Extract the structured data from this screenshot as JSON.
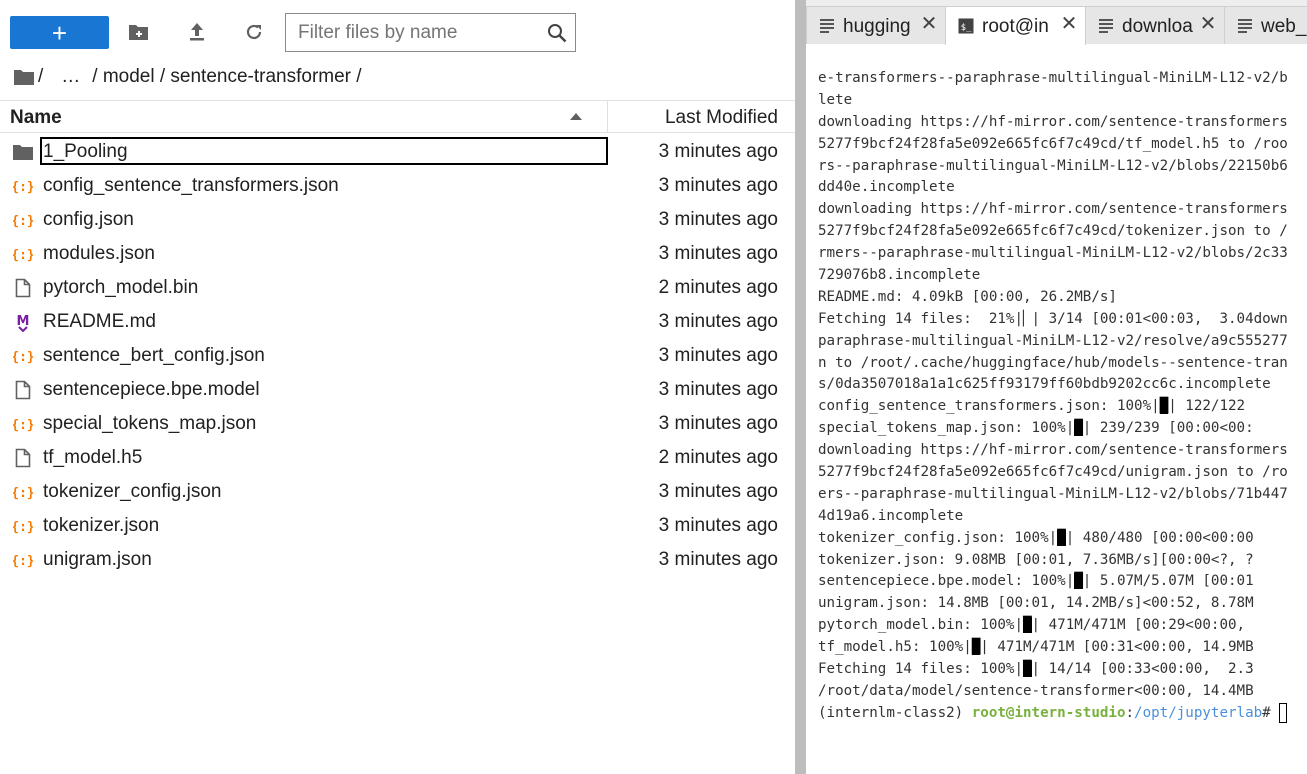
{
  "file_browser": {
    "new_label": "+",
    "search_placeholder": "Filter files by name",
    "breadcrumb": [
      "/",
      "…",
      "/ model / sentence-transformer /"
    ],
    "header": {
      "name": "Name",
      "last_modified": "Last Modified"
    },
    "files": [
      {
        "name": "1_Pooling",
        "type": "folder",
        "modified": "3 minutes ago",
        "editing": true
      },
      {
        "name": "config_sentence_transformers.json",
        "type": "json",
        "modified": "3 minutes ago"
      },
      {
        "name": "config.json",
        "type": "json",
        "modified": "3 minutes ago"
      },
      {
        "name": "modules.json",
        "type": "json",
        "modified": "3 minutes ago"
      },
      {
        "name": "pytorch_model.bin",
        "type": "file",
        "modified": "2 minutes ago"
      },
      {
        "name": "README.md",
        "type": "markdown",
        "modified": "3 minutes ago"
      },
      {
        "name": "sentence_bert_config.json",
        "type": "json",
        "modified": "3 minutes ago"
      },
      {
        "name": "sentencepiece.bpe.model",
        "type": "file",
        "modified": "3 minutes ago"
      },
      {
        "name": "special_tokens_map.json",
        "type": "json",
        "modified": "3 minutes ago"
      },
      {
        "name": "tf_model.h5",
        "type": "file",
        "modified": "2 minutes ago"
      },
      {
        "name": "tokenizer_config.json",
        "type": "json",
        "modified": "3 minutes ago"
      },
      {
        "name": "tokenizer.json",
        "type": "json",
        "modified": "3 minutes ago"
      },
      {
        "name": "unigram.json",
        "type": "json",
        "modified": "3 minutes ago"
      }
    ]
  },
  "dock": {
    "tabs": [
      {
        "label": "hugging",
        "icon": "document-icon",
        "active": false
      },
      {
        "label": "root@in",
        "icon": "terminal-icon",
        "active": true
      },
      {
        "label": "downloa",
        "icon": "document-icon",
        "active": false
      },
      {
        "label": "web_d",
        "icon": "document-icon",
        "active": false
      }
    ],
    "terminal_lines": [
      [
        [
          "e-transformers--paraphrase-multilingual-MiniLM-L12-v2/b",
          ""
        ]
      ],
      [
        [
          "lete",
          ""
        ]
      ],
      [
        [
          "downloading https://hf-mirror.com/sentence-transformers",
          ""
        ]
      ],
      [
        [
          "5277f9bcf24f28fa5e092e665fc6f7c49cd/tf_model.h5 to /roo",
          ""
        ]
      ],
      [
        [
          "rs--paraphrase-multilingual-MiniLM-L12-v2/blobs/22150b6",
          ""
        ]
      ],
      [
        [
          "dd40e.incomplete",
          ""
        ]
      ],
      [
        [
          "downloading https://hf-mirror.com/sentence-transformers",
          ""
        ]
      ],
      [
        [
          "5277f9bcf24f28fa5e092e665fc6f7c49cd/tokenizer.json to /",
          ""
        ]
      ],
      [
        [
          "rmers--paraphrase-multilingual-MiniLM-L12-v2/blobs/2c33",
          ""
        ]
      ],
      [
        [
          "729076b8.incomplete",
          ""
        ]
      ],
      [
        [
          "README.md: 4.09kB [00:00, 26.2MB/s]",
          ""
        ]
      ],
      [
        [
          "Fetching 14 files:  21%|▏| 3/14 [00:01<00:03,  3.04down",
          ""
        ]
      ],
      [
        [
          "paraphrase-multilingual-MiniLM-L12-v2/resolve/a9c555277",
          ""
        ]
      ],
      [
        [
          "n to /root/.cache/huggingface/hub/models--sentence-tran",
          ""
        ]
      ],
      [
        [
          "s/0da3507018a1a1c625ff93179ff60bdb9202cc6c.incomplete",
          ""
        ]
      ],
      [
        [
          "config_sentence_transformers.json: 100%|",
          ""
        ],
        [
          "█",
          "blk"
        ],
        [
          "| 122/122",
          ""
        ]
      ],
      [
        [
          "special_tokens_map.json: 100%|",
          ""
        ],
        [
          "█",
          "blk"
        ],
        [
          "| 239/239 [00:00<00:",
          ""
        ]
      ],
      [
        [
          "downloading https://hf-mirror.com/sentence-transformers",
          ""
        ]
      ],
      [
        [
          "5277f9bcf24f28fa5e092e665fc6f7c49cd/unigram.json to /ro",
          ""
        ]
      ],
      [
        [
          "ers--paraphrase-multilingual-MiniLM-L12-v2/blobs/71b447",
          ""
        ]
      ],
      [
        [
          "4d19a6.incomplete",
          ""
        ]
      ],
      [
        [
          "tokenizer_config.json: 100%|",
          ""
        ],
        [
          "█",
          "blk"
        ],
        [
          "| 480/480 [00:00<00:00",
          ""
        ]
      ],
      [
        [
          "tokenizer.json: 9.08MB [00:01, 7.36MB/s][00:00<?, ?",
          ""
        ]
      ],
      [
        [
          "sentencepiece.bpe.model: 100%|",
          ""
        ],
        [
          "█",
          "blk"
        ],
        [
          "| 5.07M/5.07M [00:01",
          ""
        ]
      ],
      [
        [
          "unigram.json: 14.8MB [00:01, 14.2MB/s]<00:52, 8.78M",
          ""
        ]
      ],
      [
        [
          "pytorch_model.bin: 100%|",
          ""
        ],
        [
          "█",
          "blk"
        ],
        [
          "| 471M/471M [00:29<00:00,",
          ""
        ]
      ],
      [
        [
          "tf_model.h5: 100%|",
          ""
        ],
        [
          "█",
          "blk"
        ],
        [
          "| 471M/471M [00:31<00:00, 14.9MB",
          ""
        ]
      ],
      [
        [
          "Fetching 14 files: 100%|",
          ""
        ],
        [
          "█",
          "blk"
        ],
        [
          "| 14/14 [00:33<00:00,  2.3",
          ""
        ]
      ],
      [
        [
          "/root/data/model/sentence-transformer<00:00, 14.4MB",
          ""
        ]
      ],
      [
        [
          "(internlm-class2) ",
          ""
        ],
        [
          "root@intern-studio",
          "g"
        ],
        [
          ":",
          ""
        ],
        [
          "/opt/jupyterlab",
          "b"
        ],
        [
          "# ",
          ""
        ],
        [
          "CURSOR",
          "cursor"
        ]
      ]
    ]
  },
  "colors": {
    "accent": "#1976d2",
    "json_icon": "#f57c00",
    "markdown_icon": "#7b1fa2",
    "prompt_user": "#78b13d",
    "prompt_path": "#4a90d9"
  }
}
